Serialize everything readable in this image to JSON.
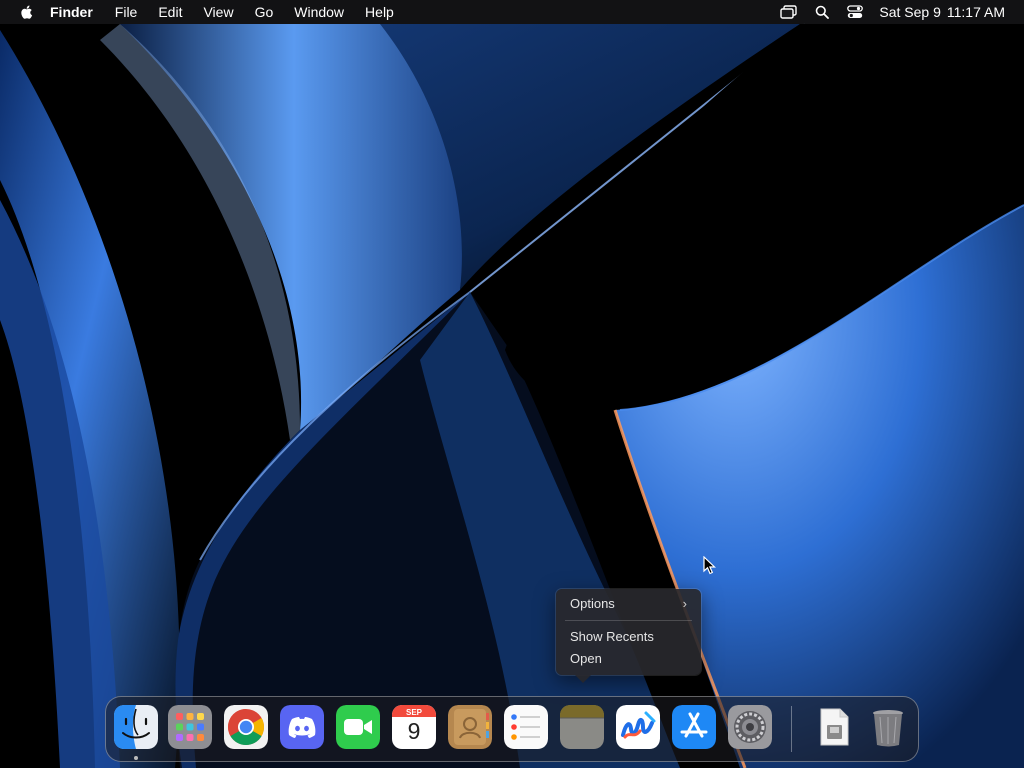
{
  "menubar": {
    "app_name": "Finder",
    "menus": [
      "File",
      "Edit",
      "View",
      "Go",
      "Window",
      "Help"
    ],
    "status_icons": [
      "screen-mirroring-icon",
      "search-icon",
      "control-center-icon"
    ],
    "clock": {
      "date": "Sat Sep 9",
      "time": "11:17 AM"
    }
  },
  "context_menu": {
    "items": [
      {
        "label": "Options",
        "has_submenu": true
      },
      {
        "label": "Show Recents"
      },
      {
        "label": "Open"
      }
    ]
  },
  "dock": {
    "apps": [
      {
        "name": "Finder",
        "icon": "finder-icon",
        "running": true
      },
      {
        "name": "Launchpad",
        "icon": "launchpad-icon"
      },
      {
        "name": "Google Chrome",
        "icon": "chrome-icon"
      },
      {
        "name": "Discord",
        "icon": "discord-icon"
      },
      {
        "name": "FaceTime",
        "icon": "facetime-icon"
      },
      {
        "name": "Calendar",
        "icon": "calendar-icon",
        "month": "SEP",
        "day": "9"
      },
      {
        "name": "Contacts",
        "icon": "contacts-icon"
      },
      {
        "name": "Reminders",
        "icon": "reminders-icon"
      },
      {
        "name": "Notes",
        "icon": "notes-icon"
      },
      {
        "name": "Freeform",
        "icon": "freeform-icon"
      },
      {
        "name": "App Store",
        "icon": "app-store-icon"
      },
      {
        "name": "System Settings",
        "icon": "system-settings-icon"
      }
    ],
    "others": [
      {
        "name": "Downloads",
        "icon": "file-stack-icon"
      },
      {
        "name": "Trash",
        "icon": "trash-icon"
      }
    ]
  },
  "colors": {
    "wallpaper_blue": "#2d6fd6",
    "wallpaper_edge": "#9ec7ff",
    "wallpaper_orange": "#ff9a5c"
  }
}
